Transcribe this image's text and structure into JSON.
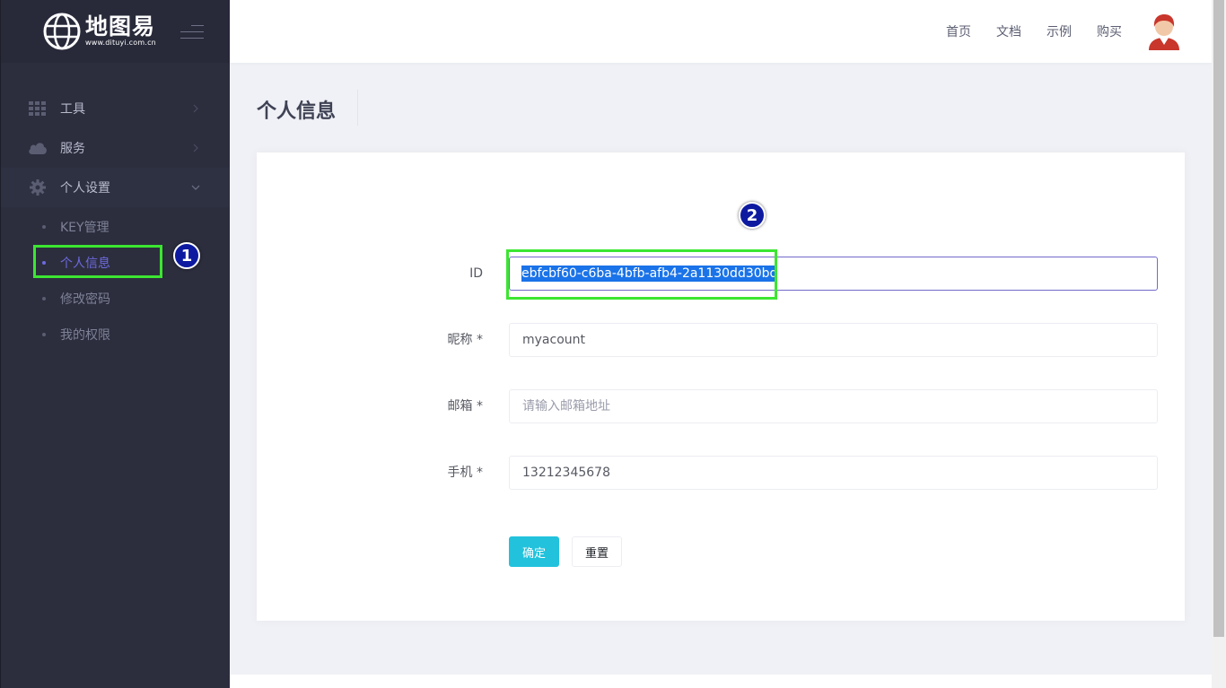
{
  "brand": {
    "name": "地图易",
    "url": "www.dituyi.com.cn"
  },
  "sidebar": {
    "items": [
      {
        "label": "工具",
        "icon": "grid-icon"
      },
      {
        "label": "服务",
        "icon": "cloud-icon"
      },
      {
        "label": "个人设置",
        "icon": "gear-icon"
      }
    ],
    "subitems": [
      {
        "label": "KEY管理"
      },
      {
        "label": "个人信息"
      },
      {
        "label": "修改密码"
      },
      {
        "label": "我的权限"
      }
    ]
  },
  "topnav": {
    "home": "首页",
    "docs": "文档",
    "examples": "示例",
    "buy": "购买"
  },
  "page": {
    "title": "个人信息"
  },
  "form": {
    "id_label": "ID",
    "id_value": "ebfcbf60-c6ba-4bfb-afb4-2a1130dd30bd",
    "nickname_label": "昵称 *",
    "nickname_value": "myacount",
    "email_label": "邮箱 *",
    "email_placeholder": "请输入邮箱地址",
    "phone_label": "手机 *",
    "phone_value": "13212345678",
    "submit": "确定",
    "reset": "重置"
  },
  "annotations": {
    "step1": "1",
    "step2": "2"
  },
  "colors": {
    "sidebar_bg": "#2c2e3e",
    "active_menu": "#6e6adf",
    "primary_button": "#22c2dc",
    "annotation_box": "#3ce631",
    "annotation_badge": "#0d1aa0"
  }
}
